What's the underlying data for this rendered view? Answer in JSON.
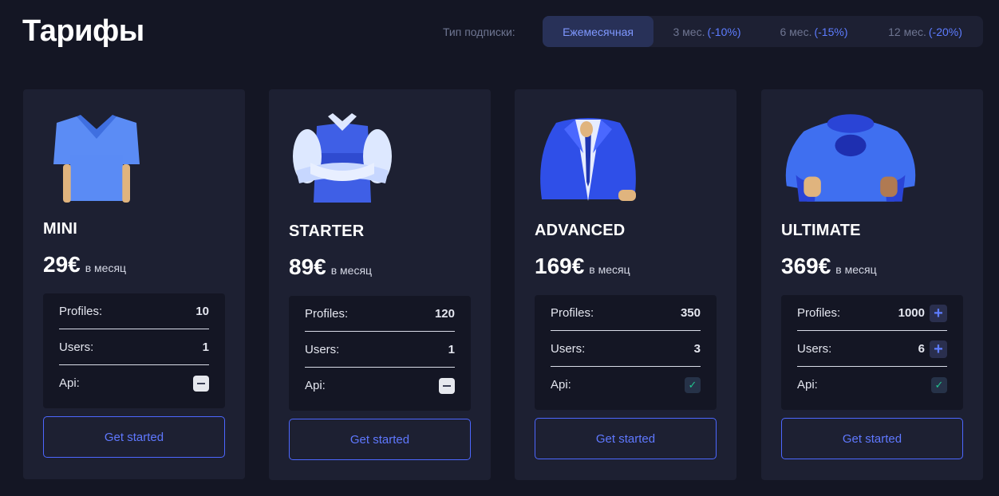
{
  "header": {
    "title": "Тарифы"
  },
  "subscription": {
    "label": "Тип подписки:",
    "tabs": [
      {
        "label": "Ежемесячная",
        "discount": "",
        "active": true
      },
      {
        "label": "3 мес.",
        "discount": "(-10%)",
        "active": false
      },
      {
        "label": "6 мес.",
        "discount": "(-15%)",
        "active": false
      },
      {
        "label": "12 мес.",
        "discount": "(-20%)",
        "active": false
      }
    ]
  },
  "plans": [
    {
      "name": "MINI",
      "price": "29€",
      "per": "в месяц",
      "icon": "tshirt-icon",
      "features": {
        "profiles_label": "Profiles:",
        "profiles": "10",
        "users_label": "Users:",
        "users": "1",
        "api_label": "Api:",
        "api": "minus-icon"
      },
      "cta": "Get started"
    },
    {
      "name": "STARTER",
      "price": "89€",
      "per": "в месяц",
      "icon": "vest-icon",
      "features": {
        "profiles_label": "Profiles:",
        "profiles": "120",
        "users_label": "Users:",
        "users": "1",
        "api_label": "Api:",
        "api": "minus-icon"
      },
      "cta": "Get started"
    },
    {
      "name": "ADVANCED",
      "price": "169€",
      "per": "в месяц",
      "icon": "suit-icon",
      "features": {
        "profiles_label": "Profiles:",
        "profiles": "350",
        "users_label": "Users:",
        "users": "3",
        "api_label": "Api:",
        "api": "check-icon"
      },
      "cta": "Get started"
    },
    {
      "name": "ULTIMATE",
      "price": "369€",
      "per": "в месяц",
      "icon": "superhero-icon",
      "features": {
        "profiles_label": "Profiles:",
        "profiles": "1000",
        "users_label": "Users:",
        "users": "6",
        "api_label": "Api:",
        "api": "check-icon"
      },
      "cta": "Get started"
    }
  ],
  "colors": {
    "background": "#141624",
    "card": "#1d2032",
    "accent": "#5d7cff",
    "check": "#22c48e"
  }
}
